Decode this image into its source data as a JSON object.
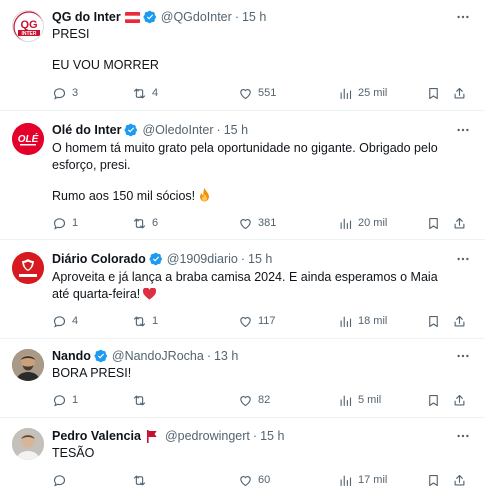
{
  "tweets": [
    {
      "name": "QG do Inter",
      "handle": "@QGdoInter",
      "time": "15 h",
      "avatar_text": "QG INTER",
      "flag": "austria-flag",
      "lines": [
        "PRESI",
        "",
        "EU VOU MORRER"
      ],
      "stats": {
        "replies": "3",
        "retweets": "4",
        "likes": "551",
        "views": "25 mil"
      }
    },
    {
      "name": "Olé do Inter",
      "handle": "@OledoInter",
      "time": "15 h",
      "avatar_text": "OLÉ",
      "lines": [
        "O homem tá muito grato pela oportunidade no gigante. Obrigado pelo esforço, presi.",
        "",
        "Rumo aos 150 mil sócios!"
      ],
      "emoji": "fire-emoji",
      "stats": {
        "replies": "1",
        "retweets": "6",
        "likes": "381",
        "views": "20 mil"
      }
    },
    {
      "name": "Diário Colorado",
      "handle": "@1909diario",
      "time": "15 h",
      "avatar_text": "DIÁRIO COLORADO",
      "lines": [
        "Aproveita e já lança a braba camisa 2024. E ainda esperamos o Maia até quarta-feira!"
      ],
      "emoji": "red-heart-emoji",
      "stats": {
        "replies": "4",
        "retweets": "1",
        "likes": "117",
        "views": "18 mil"
      }
    },
    {
      "name": "Nando",
      "handle": "@NandoJRocha",
      "time": "13 h",
      "lines": [
        "BORA PRESI!"
      ],
      "stats": {
        "replies": "1",
        "retweets": "",
        "likes": "82",
        "views": "5 mil"
      }
    },
    {
      "name": "Pedro Valencia",
      "handle": "@pedrowingert",
      "time": "15 h",
      "badge": "red-flag-badge",
      "lines": [
        "TESÃO"
      ],
      "stats": {
        "replies": "",
        "retweets": "",
        "likes": "60",
        "views": "17 mil"
      }
    }
  ],
  "colors": {
    "text": "#0f1419",
    "muted": "#536471",
    "verified": "#1d9bf0",
    "divider": "#eff3f4",
    "inter_red": "#e4002b"
  }
}
